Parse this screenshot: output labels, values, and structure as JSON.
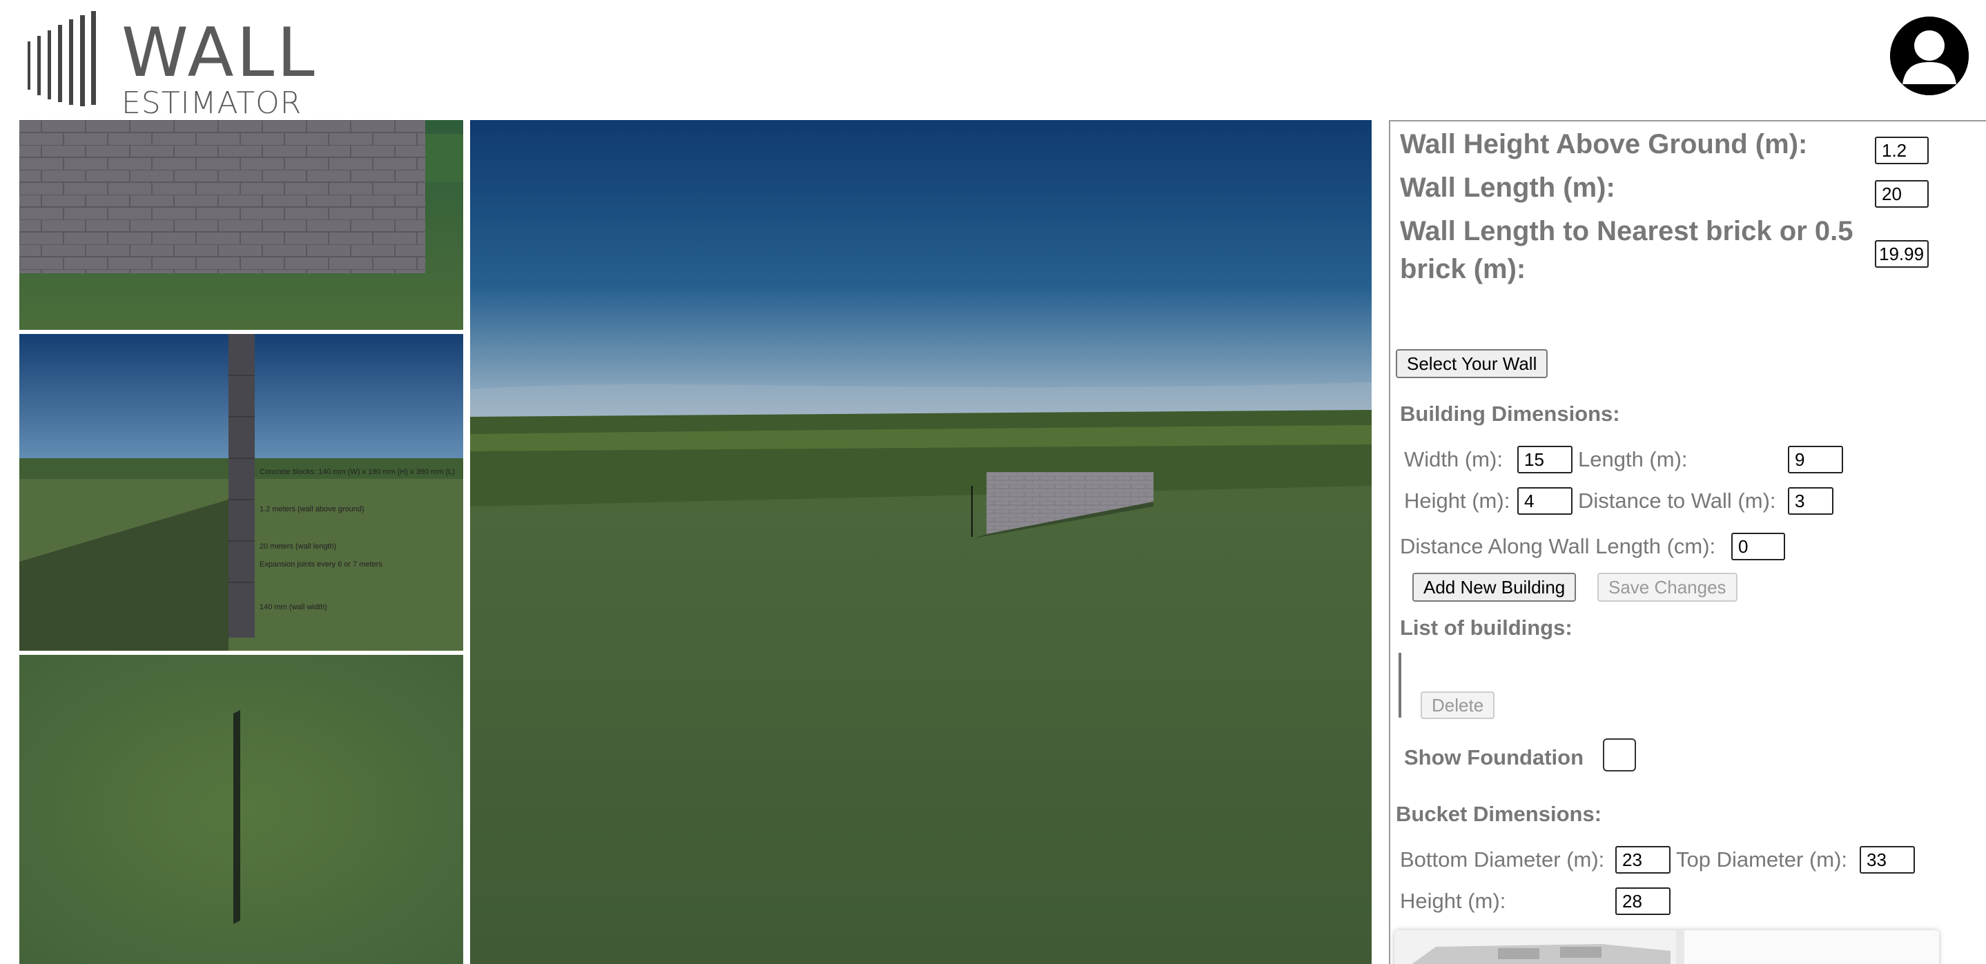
{
  "header": {
    "logo_word_1": "WALL",
    "logo_word_2": "ESTIMATOR",
    "avatar_icon": "user-avatar-icon"
  },
  "views": {
    "side_view_labels": [
      "Concrete blocks: 140 mm (W) x 190 mm (H) x 390 mm (L)",
      "1.2 meters (wall above ground)",
      "20 meters (wall length)",
      "Expansion joints every 6 or 7 meters",
      "140 mm (wall width)"
    ]
  },
  "panel": {
    "wall_height_label": "Wall Height Above Ground (m):",
    "wall_height_value": "1.2",
    "wall_length_label": "Wall Length (m):",
    "wall_length_value": "20",
    "wall_length_nearest_label": "Wall Length to Nearest brick or 0.5 brick (m):",
    "wall_length_nearest_value": "19.99",
    "select_wall_button": "Select Your Wall",
    "building_dimensions_heading": "Building Dimensions:",
    "width_label": "Width (m):",
    "width_value": "15",
    "length_label": "Length (m):",
    "length_value": "9",
    "height_label": "Height (m):",
    "height_value": "4",
    "distance_to_wall_label": "Distance to Wall (m):",
    "distance_to_wall_value": "3",
    "distance_along_label": "Distance Along Wall Length (cm):",
    "distance_along_value": "0",
    "add_building_button": "Add New Building",
    "save_changes_button": "Save Changes",
    "list_heading": "List of buildings:",
    "delete_button": "Delete",
    "show_foundation_label": "Show Foundation",
    "bucket_heading": "Bucket Dimensions:",
    "bottom_diameter_label": "Bottom Diameter (m):",
    "bottom_diameter_value": "23",
    "top_diameter_label": "Top Diameter (m):",
    "top_diameter_value": "33",
    "bucket_height_label": "Height (m):",
    "bucket_height_value": "28"
  },
  "colors": {
    "sky_top": "#1d4f8a",
    "sky_bottom": "#5c8fb6",
    "grass": "#4d6b3a",
    "block": "#6e6c72"
  }
}
